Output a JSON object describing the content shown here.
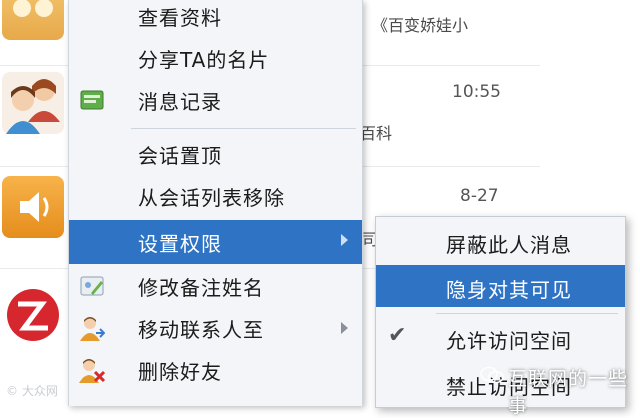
{
  "background_list": {
    "snippet_top": "《百变娇娃小",
    "time_1": "10:55",
    "snippet_mid": "百科",
    "time_2": "8-27",
    "partial_char": "司"
  },
  "context_menu": {
    "items": [
      {
        "label": "查看资料",
        "icon": ""
      },
      {
        "label": "分享TA的名片",
        "icon": ""
      },
      {
        "label": "消息记录",
        "icon": "message-record-icon"
      },
      {
        "label": "会话置顶",
        "icon": ""
      },
      {
        "label": "从会话列表移除",
        "icon": ""
      },
      {
        "label": "设置权限",
        "icon": "",
        "has_submenu": true,
        "highlighted": true
      },
      {
        "label": "修改备注姓名",
        "icon": "edit-name-icon"
      },
      {
        "label": "移动联系人至",
        "icon": "move-contact-icon",
        "has_submenu": true
      },
      {
        "label": "删除好友",
        "icon": "delete-friend-icon"
      }
    ]
  },
  "submenu": {
    "items": [
      {
        "label": "屏蔽此人消息",
        "checked": false
      },
      {
        "label": "隐身对其可见",
        "checked": false,
        "highlighted": true
      },
      {
        "label": "允许访问空间",
        "checked": true
      },
      {
        "label": "禁止访问空间",
        "checked": false
      }
    ]
  },
  "watermarks": {
    "left": "© 大众网",
    "right": "互联网的一些事"
  },
  "colors": {
    "highlight": "#2f73c4",
    "menu_bg": "#f3f5f8"
  }
}
